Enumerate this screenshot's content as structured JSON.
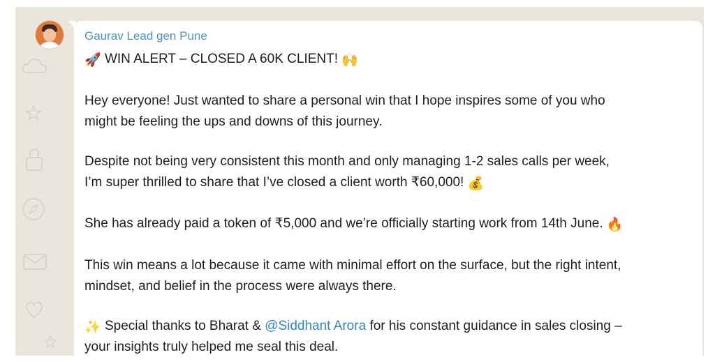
{
  "chat": {
    "sender_name": "Gaurav Lead gen Pune",
    "title_line": {
      "prefix_emoji": "🚀",
      "text": "WIN ALERT – CLOSED A 60K CLIENT!",
      "suffix_emoji": "🙌"
    },
    "p1": {
      "line1": "Hey everyone! Just wanted to share a personal win that I hope inspires some of you who",
      "line2": "might be feeling the ups and downs of this journey."
    },
    "p2": {
      "line1": "Despite not being very consistent this month and only managing 1-2 sales calls per week,",
      "line2": "I’m super thrilled to share that I’ve closed a client worth ₹60,000!",
      "emoji": "💰"
    },
    "p3": {
      "line1": "She has already paid a token of ₹5,000 and we’re officially starting work from 14th June.",
      "emoji": "🔥"
    },
    "p4": {
      "line1": "This win means a lot because it came with minimal effort on the surface, but the right intent,",
      "line2": "mindset, and belief in the process were always there."
    },
    "p5": {
      "emoji": "✨",
      "before": "Special thanks to Bharat &",
      "mention": "@Siddhant Arora",
      "after": "for his constant guidance in sales closing –",
      "line2": "your insights truly helped me seal this deal."
    }
  },
  "colors": {
    "chat_background": "#ebe6dc",
    "bubble": "#ffffff",
    "sender_name": "#4a90c2",
    "mention": "#2f86c7",
    "text": "#1e1e1e"
  },
  "icons": {
    "avatar": "profile-photo",
    "doodles": [
      "cloud-doodle",
      "lock-doodle",
      "compass-doodle",
      "envelope-doodle",
      "star-doodle"
    ]
  }
}
